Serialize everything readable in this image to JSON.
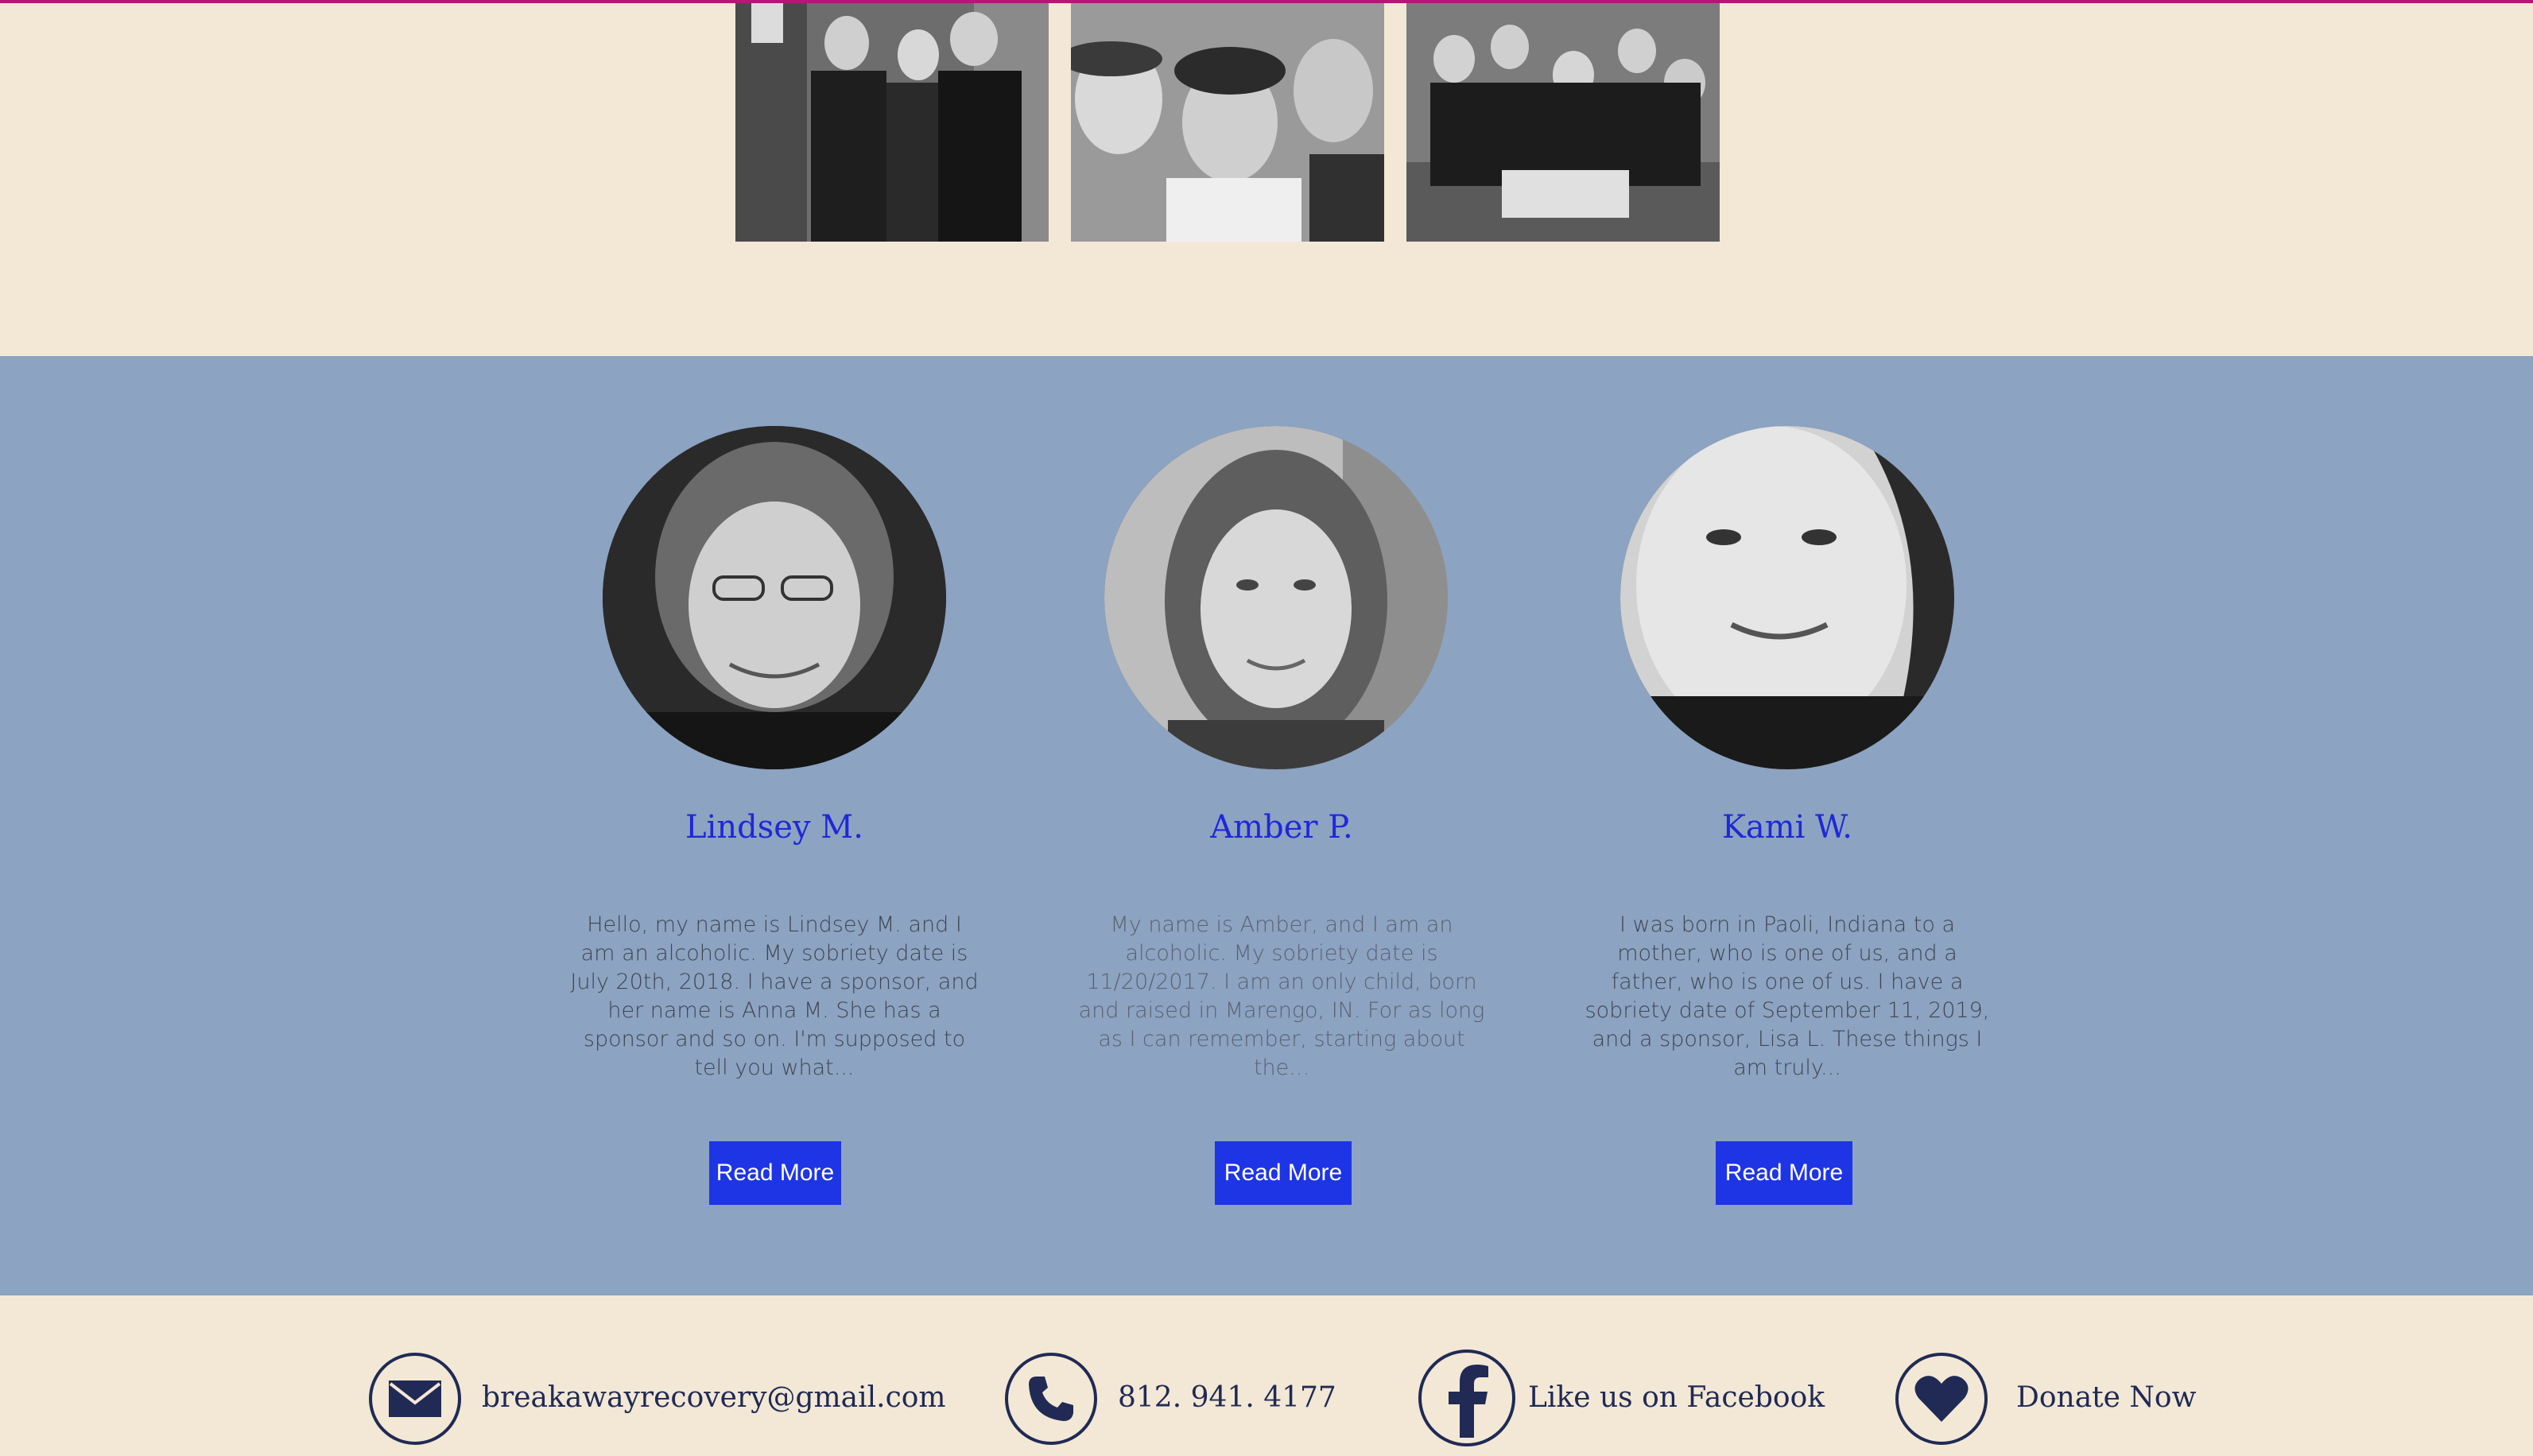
{
  "members": [
    {
      "name": "Lindsey M.",
      "excerpt": "Hello, my name is Lindsey M. and I am an alcoholic. My sobriety date is July 20th, 2018. I have a sponsor, and her name is Anna M. She has a sponsor and so on. I'm supposed to tell you what...",
      "button": "Read More"
    },
    {
      "name": "Amber P.",
      "excerpt": "My name is Amber, and I am an alcoholic. My sobriety date is 11/20/2017. I am an only child, born and raised in Marengo, IN. For as long as I can remember, starting about the...",
      "button": "Read More"
    },
    {
      "name": "Kami W.",
      "excerpt": "I was born in Paoli, Indiana to a mother, who is one of us, and a father, who is one of us. I have a sobriety date of September 11, 2019, and a sponsor, Lisa L. These things I am truly...",
      "button": "Read More"
    }
  ],
  "contacts": {
    "email": "breakawayrecovery@gmail.com",
    "phone": "812. 941. 4177",
    "facebook": "Like us on Facebook",
    "donate": "Donate Now"
  },
  "icons": [
    "mail-icon",
    "phone-icon",
    "facebook-icon",
    "heart-icon"
  ],
  "colors": {
    "page_background": "#f3e8d5",
    "section_background": "#8ca3c2",
    "accent_rule": "#b0187a",
    "name_text": "#1e28d8",
    "button": "#1e35e5",
    "footer_ink": "#202a55"
  }
}
